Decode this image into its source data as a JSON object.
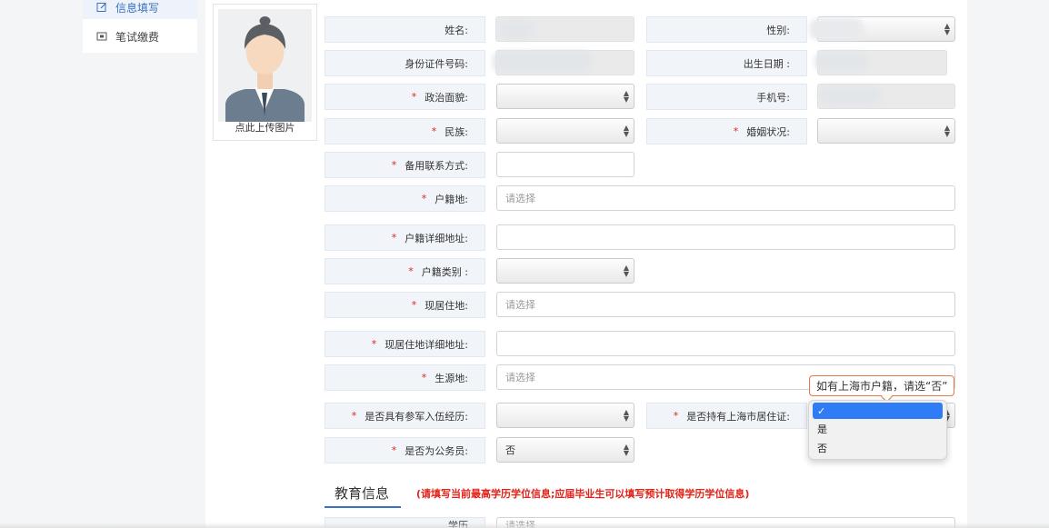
{
  "sidebar": {
    "items": [
      {
        "label": "信息填写",
        "icon": "edit-icon"
      },
      {
        "label": "笔试缴费",
        "icon": "card-icon"
      }
    ]
  },
  "photo": {
    "caption": "点此上传图片",
    "icon": "avatar-placeholder"
  },
  "form": {
    "name_label": "姓名:",
    "gender_label": "性别:",
    "idcard_label": "身份证件号码:",
    "birth_label": "出生日期 :",
    "political_label": "政治面貌:",
    "phone_label": "手机号:",
    "ethnic_label": "民族:",
    "marital_label": "婚姻状况:",
    "alt_contact_label": "备用联系方式:",
    "hukou_label": "户籍地:",
    "hukou_placeholder": "请选择",
    "hukou_addr_label": "户籍详细地址:",
    "hukou_type_label": "户籍类别 :",
    "residence_label": "现居住地:",
    "residence_placeholder": "请选择",
    "residence_addr_label": "现居住地详细地址:",
    "origin_label": "生源地:",
    "origin_placeholder": "请选择",
    "military_label": "是否具有参军入伍经历:",
    "sh_permit_label": "是否持有上海市居住证:",
    "civil_servant_label": "是否为公务员:",
    "civil_servant_value": "否",
    "required_mark": "*"
  },
  "tooltip": {
    "text": "如有上海市户籍，请选“否”"
  },
  "dropdown": {
    "checkmark": "✓",
    "options": [
      "是",
      "否"
    ]
  },
  "education": {
    "title": "教育信息",
    "note": "(请填写当前最高学历学位信息;应届毕业生可以填写预计取得学历学位信息)",
    "next_label": "学历",
    "next_placeholder": "请选择"
  },
  "colors": {
    "accent": "#3a71c1",
    "required": "#e2231a",
    "tooltip_border": "#e8774b",
    "option_highlight": "#2f7cf6"
  }
}
